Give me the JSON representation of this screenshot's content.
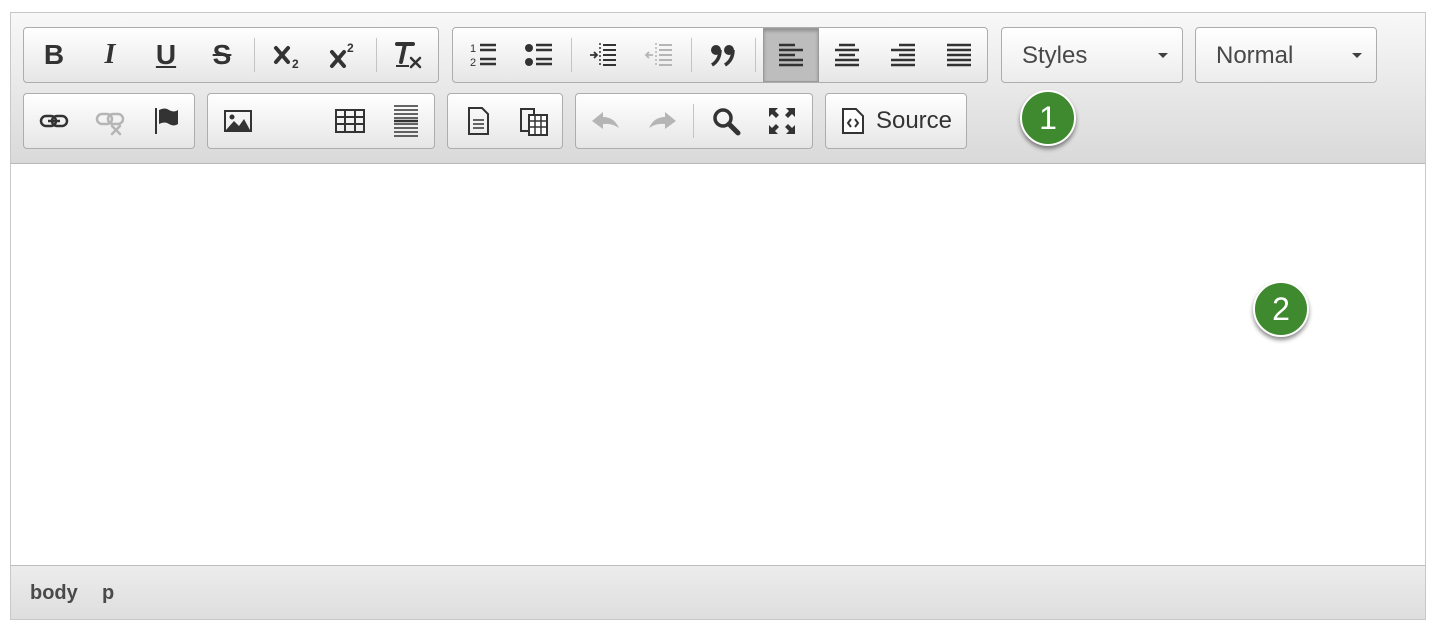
{
  "toolbar": {
    "basicstyles": [
      {
        "id": "bold",
        "glyph": "B",
        "icon": "bold-icon"
      },
      {
        "id": "italic",
        "glyph": "I",
        "icon": "italic-icon"
      },
      {
        "id": "underline",
        "glyph": "U",
        "icon": "underline-icon"
      },
      {
        "id": "strike",
        "glyph": "S",
        "icon": "strikethrough-icon"
      },
      {
        "id": "subscript",
        "icon": "subscript-icon"
      },
      {
        "id": "superscript",
        "icon": "superscript-icon"
      },
      {
        "id": "remove-format",
        "icon": "remove-format-icon"
      }
    ],
    "paragraph": [
      {
        "id": "numbered-list",
        "icon": "numbered-list-icon"
      },
      {
        "id": "bulleted-list",
        "icon": "bulleted-list-icon"
      },
      {
        "id": "indent",
        "icon": "indent-icon"
      },
      {
        "id": "outdent",
        "icon": "outdent-icon",
        "disabled": true
      },
      {
        "id": "blockquote",
        "icon": "blockquote-icon"
      },
      {
        "id": "align-left",
        "icon": "align-left-icon",
        "active": true
      },
      {
        "id": "align-center",
        "icon": "align-center-icon"
      },
      {
        "id": "align-right",
        "icon": "align-right-icon"
      },
      {
        "id": "align-justify",
        "icon": "align-justify-icon"
      }
    ],
    "styles_combo": {
      "label": "Styles"
    },
    "format_combo": {
      "label": "Normal"
    },
    "links": [
      {
        "id": "link",
        "icon": "link-icon"
      },
      {
        "id": "unlink",
        "icon": "unlink-icon",
        "disabled": true
      },
      {
        "id": "anchor",
        "icon": "anchor-flag-icon"
      }
    ],
    "insert": [
      {
        "id": "image",
        "icon": "image-icon"
      },
      {
        "id": "table",
        "icon": "table-icon"
      },
      {
        "id": "horizontal-rule",
        "icon": "horizontal-rule-icon"
      }
    ],
    "clipboard": [
      {
        "id": "templates",
        "icon": "document-icon"
      },
      {
        "id": "paste-word",
        "icon": "paste-from-word-icon"
      }
    ],
    "tools": [
      {
        "id": "undo",
        "icon": "undo-icon",
        "disabled": true
      },
      {
        "id": "redo",
        "icon": "redo-icon",
        "disabled": true
      },
      {
        "id": "find",
        "icon": "search-icon"
      },
      {
        "id": "maximize",
        "icon": "maximize-icon"
      }
    ],
    "source": {
      "label": "Source",
      "icon": "source-icon"
    }
  },
  "colors": {
    "marker": "#3f8a2f",
    "icon": "#333333",
    "icon_disabled": "#b5b5b5"
  },
  "markers": [
    "1",
    "2"
  ],
  "statusbar": {
    "path": [
      "body",
      "p"
    ]
  }
}
